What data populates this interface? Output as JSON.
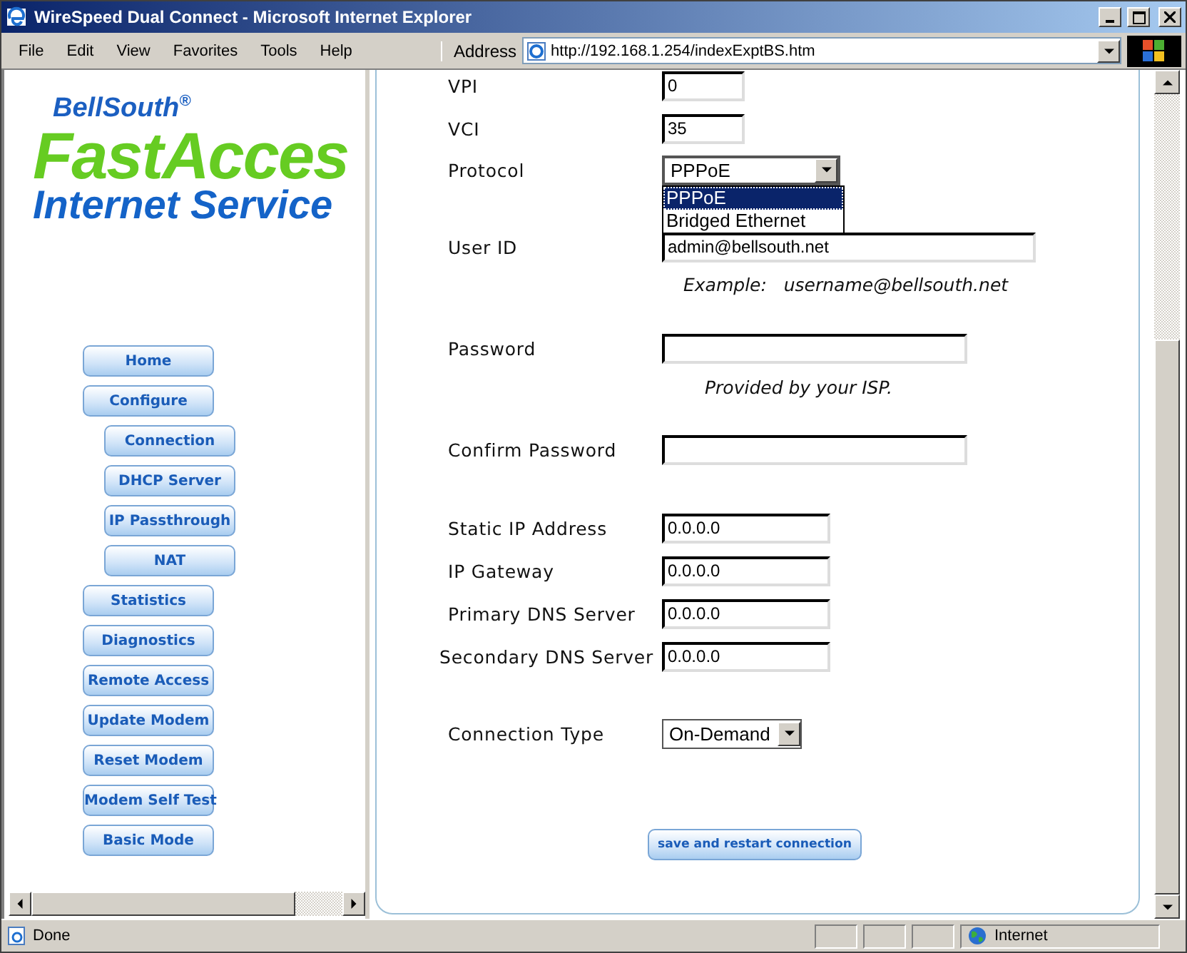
{
  "window": {
    "title": "WireSpeed Dual Connect - Microsoft Internet Explorer"
  },
  "menu": [
    "File",
    "Edit",
    "View",
    "Favorites",
    "Tools",
    "Help"
  ],
  "address": {
    "label": "Address",
    "url": "http://192.168.1.254/indexExptBS.htm"
  },
  "logo": {
    "brand": "BellSouth$^{®}$",
    "product": "FastAcces",
    "tagline": "Internet Service"
  },
  "sidebar": {
    "items": [
      {
        "label": "Home"
      },
      {
        "label": "Configure",
        "children": [
          {
            "label": "Connection"
          },
          {
            "label": "DHCP Server"
          },
          {
            "label": "IP Passthrough"
          },
          {
            "label": "NAT"
          }
        ]
      },
      {
        "label": "Statistics"
      },
      {
        "label": "Diagnostics"
      },
      {
        "label": "Remote Access"
      },
      {
        "label": "Update Modem"
      },
      {
        "label": "Reset Modem"
      },
      {
        "label": "Modem Self Test"
      },
      {
        "label": "Basic Mode"
      }
    ]
  },
  "form": {
    "rows": [
      {
        "kind": "text",
        "label": "VPI",
        "value": "0"
      },
      {
        "kind": "text",
        "label": "VCI",
        "value": "35"
      },
      {
        "kind": "select",
        "label": "Protocol",
        "value": "PPPoE",
        "expanded": true,
        "options": [
          {
            "label": "PPPoE",
            "selected": true
          },
          {
            "label": "Bridged Ethernet",
            "selected": false
          }
        ]
      },
      {
        "kind": "text",
        "label": "User ID",
        "value": "admin@bellsouth.net"
      },
      {
        "kind": "note",
        "text": "Example:   username@bellsouth.net"
      },
      {
        "kind": "text",
        "label": "Password",
        "value": ""
      },
      {
        "kind": "note",
        "text": "Provided by your ISP."
      },
      {
        "kind": "text",
        "label": "Confirm Password",
        "value": ""
      },
      {
        "kind": "text",
        "label": "Static IP Address",
        "value": "0.0.0.0"
      },
      {
        "kind": "text",
        "label": "IP Gateway",
        "value": "0.0.0.0"
      },
      {
        "kind": "text",
        "label": "Primary DNS Server",
        "value": "0.0.0.0"
      },
      {
        "kind": "text",
        "label": "Secondary DNS Server",
        "value": "0.0.0.0"
      },
      {
        "kind": "select",
        "label": "Connection Type",
        "value": "On-Demand",
        "expanded": false
      },
      {
        "kind": "button",
        "label": "save and restart connection"
      }
    ]
  },
  "status_bar": {
    "text": "Done",
    "zone": "Internet"
  }
}
